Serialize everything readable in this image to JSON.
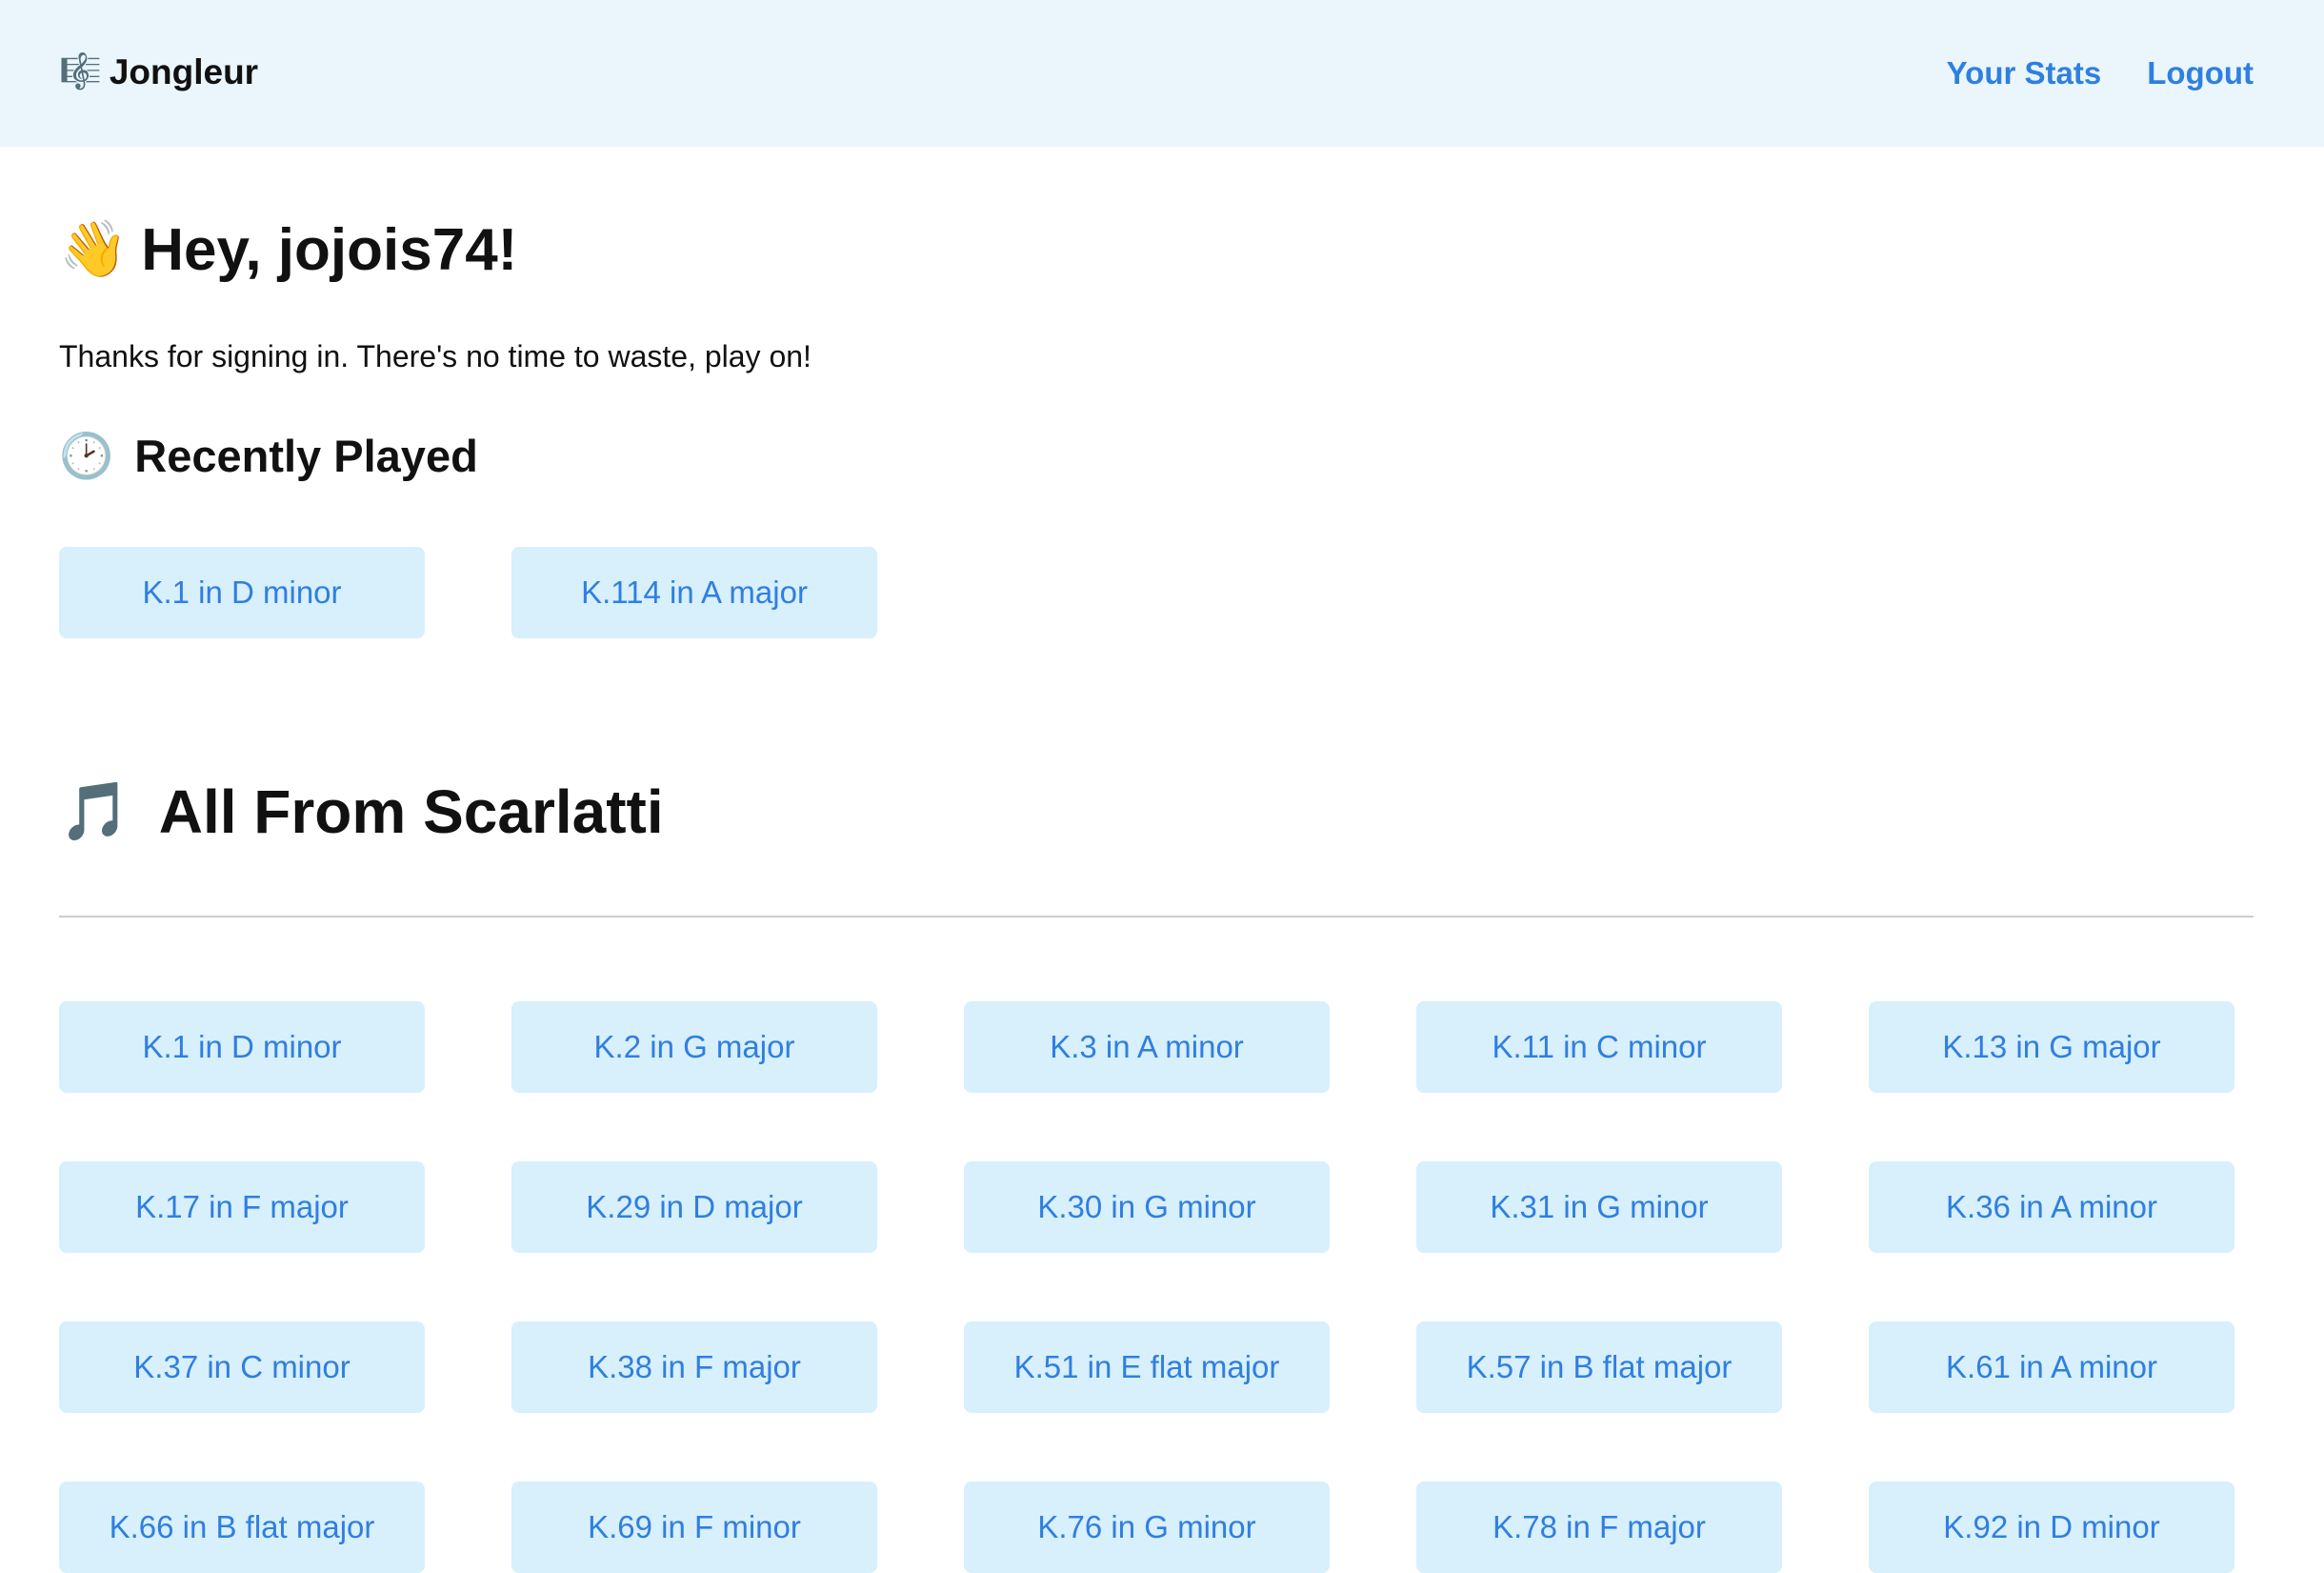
{
  "header": {
    "brand_icon": "🎼",
    "brand_name": "Jongleur",
    "nav": {
      "stats": "Your Stats",
      "logout": "Logout"
    }
  },
  "greeting": {
    "emoji": "👋",
    "title": "Hey, jojois74!",
    "intro": "Thanks for signing in. There's no time to waste, play on!"
  },
  "recent": {
    "emoji": "🕑",
    "title": "Recently Played",
    "items": [
      "K.1 in D minor",
      "K.114 in A major"
    ]
  },
  "all": {
    "emoji": "🎵",
    "title": "All From Scarlatti",
    "items": [
      "K.1 in D minor",
      "K.2 in G major",
      "K.3 in A minor",
      "K.11 in C minor",
      "K.13 in G major",
      "K.17 in F major",
      "K.29 in D major",
      "K.30 in G minor",
      "K.31 in G minor",
      "K.36 in A minor",
      "K.37 in C minor",
      "K.38 in F major",
      "K.51 in E flat major",
      "K.57 in B flat major",
      "K.61 in A minor",
      "K.66 in B flat major",
      "K.69 in F minor",
      "K.76 in G minor",
      "K.78 in F major",
      "K.92 in D minor"
    ]
  },
  "colors": {
    "header_bg": "#eaf6fc",
    "link": "#2f7fe0",
    "button_bg": "#d8effc"
  }
}
